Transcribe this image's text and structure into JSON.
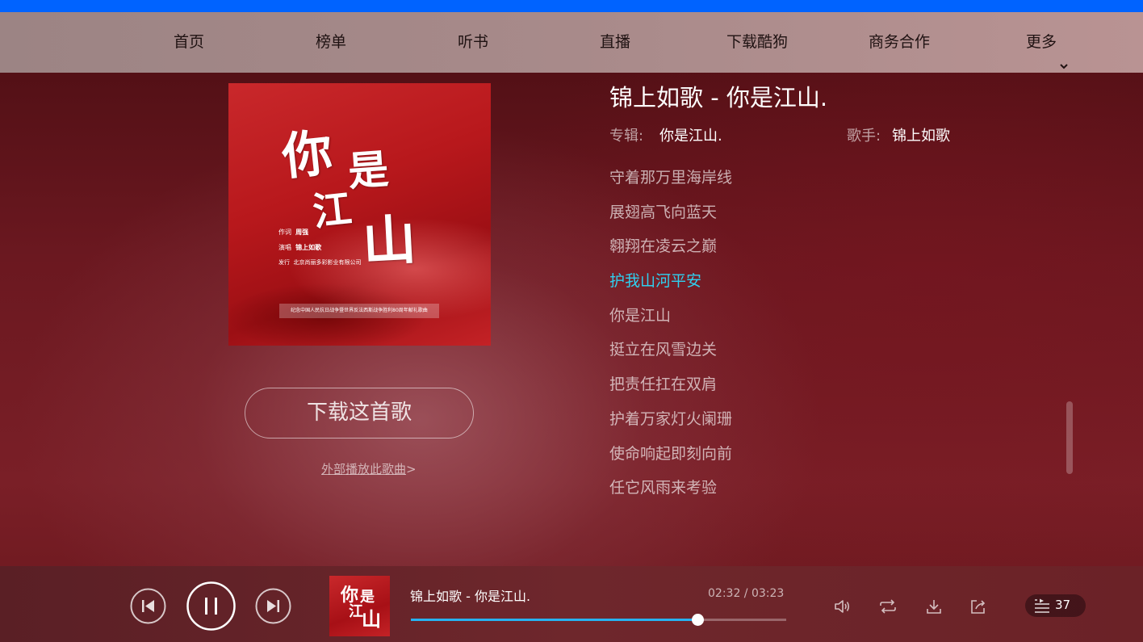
{
  "nav": {
    "items": [
      {
        "label": "首页"
      },
      {
        "label": "榜单"
      },
      {
        "label": "听书"
      },
      {
        "label": "直播"
      },
      {
        "label": "下载酷狗"
      },
      {
        "label": "商务合作"
      },
      {
        "label": "更多"
      }
    ]
  },
  "cover": {
    "title_chars": [
      "你",
      "是",
      "江",
      "山"
    ],
    "credits": [
      {
        "role": "作词",
        "name": "周强"
      },
      {
        "role": "演唱",
        "name": "锦上如歌"
      },
      {
        "role": "发行",
        "name": "北京尚丽多彩影业有限公司"
      }
    ],
    "banner": "纪念中国人民抗日战争暨世界反法西斯战争胜利80周年献礼歌曲"
  },
  "left": {
    "download_button": "下载这首歌",
    "external_play_link": "外部播放此歌曲",
    "external_play_arrow": ">"
  },
  "song": {
    "title": "锦上如歌 - 你是江山.",
    "album_label": "专辑:",
    "album": "你是江山.",
    "singer_label": "歌手:",
    "singer": "锦上如歌"
  },
  "lyrics": [
    {
      "text": "守着那万里海岸线",
      "active": false
    },
    {
      "text": "展翅高飞向蓝天",
      "active": false
    },
    {
      "text": "翱翔在凌云之巅",
      "active": false
    },
    {
      "text": "护我山河平安",
      "active": true
    },
    {
      "text": "你是江山",
      "active": false
    },
    {
      "text": "挺立在风雪边关",
      "active": false
    },
    {
      "text": "把责任扛在双肩",
      "active": false
    },
    {
      "text": "护着万家灯火阑珊",
      "active": false
    },
    {
      "text": "使命响起即刻向前",
      "active": false
    },
    {
      "text": "任它风雨来考验",
      "active": false
    }
  ],
  "player": {
    "now_playing": "锦上如歌 - 你是江山.",
    "time": "02:32 / 03:23",
    "progress": 0.7645,
    "mini_cover_chars": [
      "你",
      "是",
      "江",
      "山"
    ],
    "playlist_count": "37",
    "accent_color": "#27b2f0",
    "icons": [
      "previous-icon",
      "pause-icon",
      "next-icon",
      "volume-icon",
      "repeat-icon",
      "download-icon",
      "share-icon",
      "playlist-icon"
    ]
  },
  "colors": {
    "top_strip": "#0063ff",
    "active_lyric": "#2fd0f0"
  }
}
